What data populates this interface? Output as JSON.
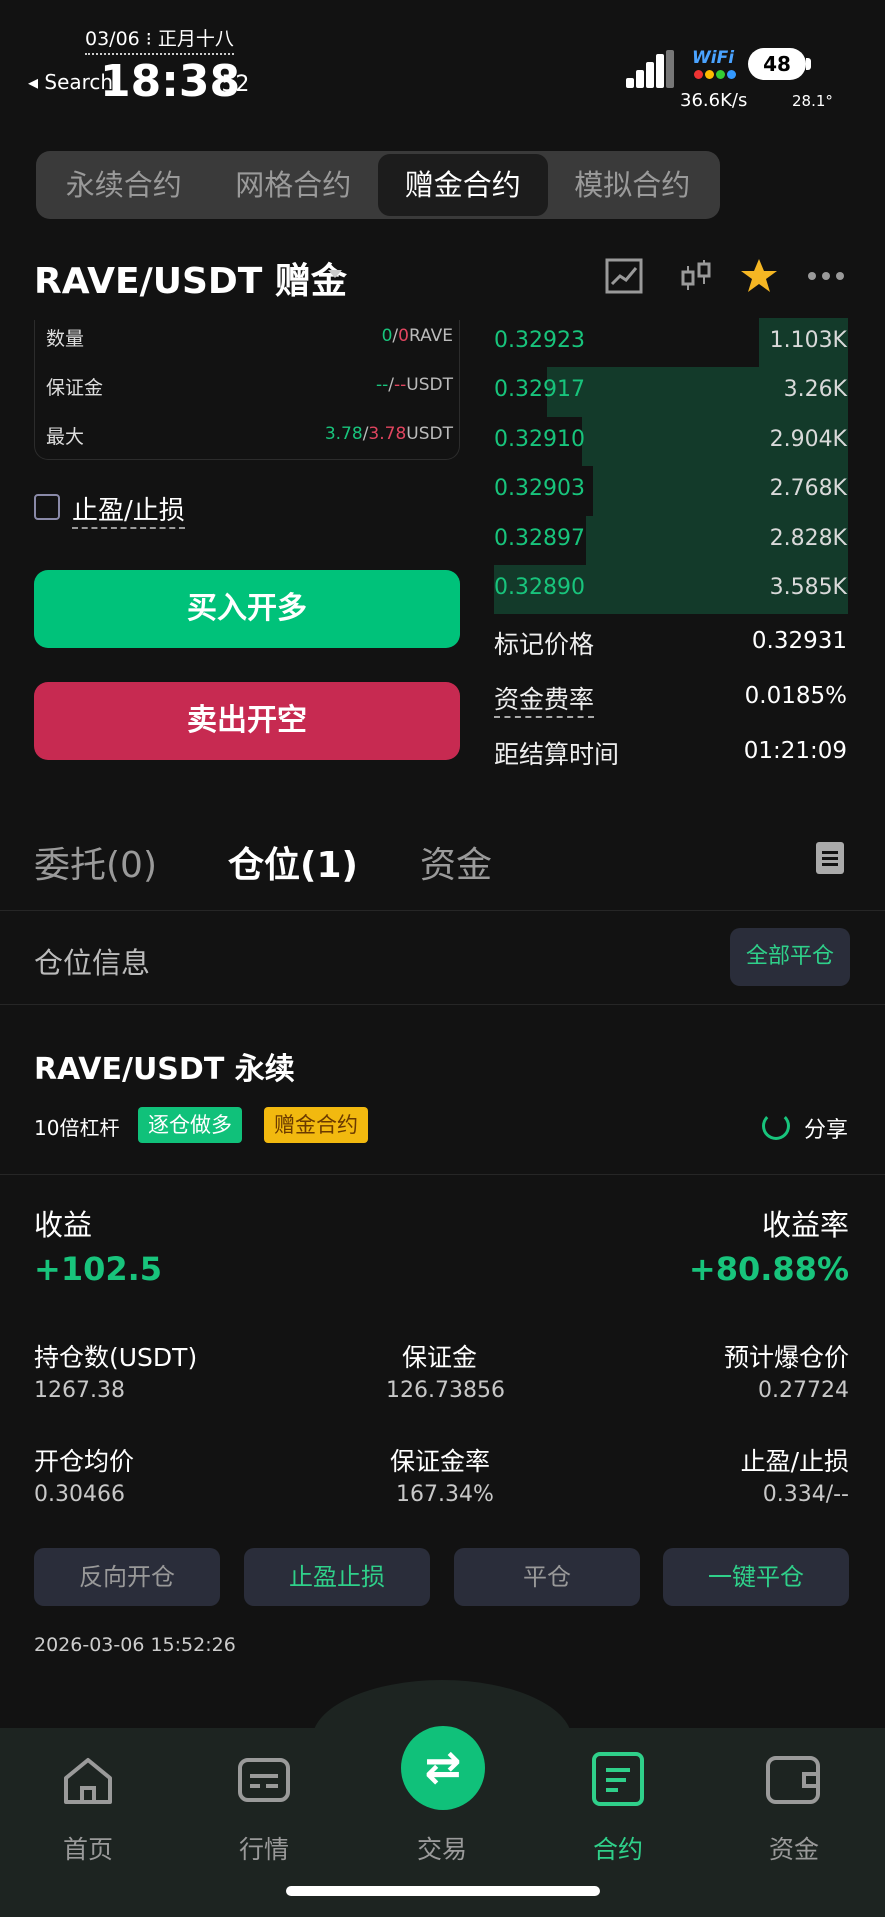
{
  "status_bar": {
    "date": "03/06 ⁝ 正月十八",
    "back_label": "◂ Search",
    "time": "18:38",
    "seconds": ":52",
    "wifi": "WiFi",
    "battery": "48",
    "net_speed": "36.6K/s",
    "temperature": "28.1°"
  },
  "top_tabs": [
    {
      "label": "永续合约",
      "active": false
    },
    {
      "label": "网格合约",
      "active": false
    },
    {
      "label": "赠金合约",
      "active": true
    },
    {
      "label": "模拟合约",
      "active": false
    }
  ],
  "header": {
    "pair": "RAVE/USDT 赠金",
    "icons": [
      "chart-line-icon",
      "candlestick-icon",
      "star-icon",
      "more-icon"
    ],
    "star_color": "#f5b623"
  },
  "order_form": {
    "rows": [
      {
        "label": "数量",
        "value_a": "0",
        "sep": "/",
        "value_b": "0",
        "unit": "RAVE"
      },
      {
        "label": "保证金",
        "value_a": "--",
        "sep": "/",
        "value_b": "--",
        "unit": "USDT"
      },
      {
        "label": "最大",
        "value_a": "3.78",
        "sep": "/",
        "value_b": "3.78",
        "unit": "USDT"
      }
    ],
    "tpsl_label": "止盈/止损",
    "buy_label": "买入开多",
    "sell_label": "卖出开空"
  },
  "order_book": {
    "bids": [
      {
        "price": "0.32923",
        "qty": "1.103K",
        "depth": 0.25
      },
      {
        "price": "0.32917",
        "qty": "3.26K",
        "depth": 0.85
      },
      {
        "price": "0.32910",
        "qty": "2.904K",
        "depth": 0.75
      },
      {
        "price": "0.32903",
        "qty": "2.768K",
        "depth": 0.72
      },
      {
        "price": "0.32897",
        "qty": "2.828K",
        "depth": 0.74
      },
      {
        "price": "0.32890",
        "qty": "3.585K",
        "depth": 1.0
      }
    ],
    "mark_price_label": "标记价格",
    "mark_price": "0.32931",
    "funding_rate_label": "资金费率",
    "funding_rate": "0.0185%",
    "settle_label": "距结算时间",
    "settle_time": "01:21:09"
  },
  "bottom_tabs": [
    {
      "label": "委托(0)",
      "active": false
    },
    {
      "label": "仓位(1)",
      "active": true
    },
    {
      "label": "资金",
      "active": false
    }
  ],
  "positions": {
    "section_label": "仓位信息",
    "close_all": "全部平仓",
    "title": "RAVE/USDT 永续",
    "leverage": "10倍杠杆",
    "tag_mode": "逐仓做多",
    "tag_type": "赠金合约",
    "share": "分享",
    "pnl_label": "收益",
    "pnl": "+102.5",
    "roe_label": "收益率",
    "roe": "+80.88%",
    "stats": [
      {
        "label": "持仓数(USDT)",
        "value": "1267.38"
      },
      {
        "label": "保证金",
        "value": "126.73856"
      },
      {
        "label": "预计爆仓价",
        "value": "0.27724"
      },
      {
        "label": "开仓均价",
        "value": "0.30466"
      },
      {
        "label": "保证金率",
        "value": "167.34%"
      },
      {
        "label": "止盈/止损",
        "value": "0.334/--"
      }
    ],
    "actions": [
      "反向开仓",
      "止盈止损",
      "平仓",
      "一键平仓"
    ],
    "timestamp": "2026-03-06 15:52:26"
  },
  "nav": [
    {
      "label": "首页",
      "icon": "home-icon",
      "active": false
    },
    {
      "label": "行情",
      "icon": "market-icon",
      "active": false
    },
    {
      "label": "交易",
      "icon": "swap-icon",
      "active": false
    },
    {
      "label": "合约",
      "icon": "contract-icon",
      "active": true
    },
    {
      "label": "资金",
      "icon": "wallet-icon",
      "active": false
    }
  ],
  "colors": {
    "green": "#18c47c",
    "red": "#c72a51",
    "accent": "#2fd08a",
    "background": "#121212"
  }
}
